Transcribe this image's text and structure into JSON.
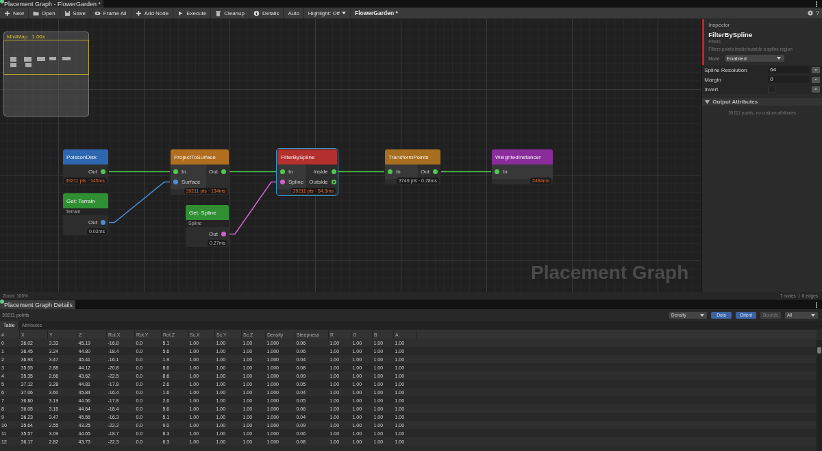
{
  "window": {
    "title": "Placement Graph - FlowerGarden *"
  },
  "toolbar": {
    "items": [
      {
        "kind": "button",
        "label": "New"
      },
      {
        "kind": "button",
        "label": "Open"
      },
      {
        "kind": "button",
        "label": "Save"
      },
      {
        "kind": "button",
        "label": "Frame All"
      },
      {
        "kind": "button",
        "label": "Add Node"
      },
      {
        "kind": "button",
        "label": "Execute"
      },
      {
        "kind": "button",
        "label": "Cleanup"
      },
      {
        "kind": "button",
        "label": "Details"
      },
      {
        "kind": "text",
        "label": "Auto"
      },
      {
        "kind": "dropdown",
        "label": "Highlight: Off"
      }
    ],
    "document": "FlowerGarden *",
    "help": "?"
  },
  "graph": {
    "minimap": {
      "label": "MiniMap",
      "zoom": "1.00x"
    },
    "watermark": "Placement Graph",
    "nodes": [
      {
        "title": "PoissonDisk",
        "color": "#2d67b2",
        "selected": false,
        "outputs": [
          {
            "label": "Out",
            "color": "#4fc94f",
            "connected": true
          }
        ],
        "stats": "39211 pts · 145ms",
        "stats_hot": true
      },
      {
        "title": "Get: Terrain",
        "color": "#2f8f33",
        "subtitle": "Terrain",
        "selected": false,
        "outputs": [
          {
            "label": "Out",
            "color": "#4d8fd6",
            "connected": true
          }
        ],
        "stats": "0.02ms",
        "stats_hot": false
      },
      {
        "title": "ProjectToSurface",
        "color": "#b06e1e",
        "selected": false,
        "inputs": [
          {
            "label": "In",
            "color": "#4fc94f",
            "connected": true
          },
          {
            "label": "Surface",
            "color": "#4d8fd6",
            "connected": true
          }
        ],
        "outputs": [
          {
            "label": "Out",
            "color": "#4fc94f",
            "connected": true
          }
        ],
        "stats": "39211 pts · 134ms",
        "stats_hot": true
      },
      {
        "title": "Get: Spline",
        "color": "#2f8f33",
        "subtitle": "Spline",
        "selected": false,
        "outputs": [
          {
            "label": "Out",
            "color": "#d35fd3",
            "connected": true
          }
        ],
        "stats": "0.27ms",
        "stats_hot": false
      },
      {
        "title": "FilterBySpline",
        "color": "#b3302f",
        "selected": true,
        "inputs": [
          {
            "label": "In",
            "color": "#4fc94f",
            "connected": true
          },
          {
            "label": "Spline",
            "color": "#d35fd3",
            "connected": true
          }
        ],
        "outputs": [
          {
            "label": "Inside",
            "color": "#4fc94f",
            "connected": true
          },
          {
            "label": "Outside",
            "color": "#4fc94f",
            "connected": false
          }
        ],
        "stats": "39211 pts · 54.3ms",
        "stats_hot": true
      },
      {
        "title": "TransformPoints",
        "color": "#a86e1f",
        "selected": false,
        "inputs": [
          {
            "label": "In",
            "color": "#4fc94f",
            "connected": true
          }
        ],
        "outputs": [
          {
            "label": "Out",
            "color": "#4fc94f",
            "connected": true
          }
        ],
        "stats": "3749 pts · 0.28ms",
        "stats_hot": false
      },
      {
        "title": "WeightedInstancer",
        "color": "#8a2c9c",
        "selected": false,
        "inputs": [
          {
            "label": "In",
            "color": "#4fc94f",
            "connected": true
          }
        ],
        "stats": "2484ms",
        "stats_hot": true
      }
    ],
    "status": {
      "zoom": "Zoom: 100%",
      "nodes": "7 nodes",
      "edges": "6 edges"
    }
  },
  "inspector": {
    "header": "Inspector",
    "title": "FilterBySpline",
    "category": "Filters",
    "description": "Filters points inside/outside a spline region",
    "mode": {
      "label": "Mode",
      "value": "Enabled"
    },
    "properties": [
      {
        "kind": "number",
        "label": "Spline Resolution",
        "value": "64"
      },
      {
        "kind": "number",
        "label": "Margin",
        "value": "0"
      },
      {
        "kind": "checkbox",
        "label": "Invert",
        "checked": false
      }
    ],
    "output_section": {
      "title": "Output Attributes",
      "expanded": true,
      "text": "39211 points, no custom attributes"
    }
  },
  "details": {
    "title": "Placement Graph Details",
    "count": "39211 points",
    "color_by": "Density",
    "toggles": [
      {
        "label": "Dots",
        "on": true
      },
      {
        "label": "Orient",
        "on": true
      },
      {
        "label": "Bounds",
        "on": false
      }
    ],
    "filter": "All",
    "tabs": [
      {
        "label": "Table",
        "selected": true
      },
      {
        "label": "Attributes",
        "selected": false
      }
    ],
    "table": {
      "columns": [
        "#",
        "X",
        "Y",
        "Z",
        "Rot.X",
        "Rot.Y",
        "Rot.Z",
        "Sc.X",
        "Sc.Y",
        "Sc.Z",
        "Density",
        "Steepness",
        "R",
        "G",
        "B",
        "A"
      ],
      "rows": [
        [
          "0",
          "36.02",
          "3.33",
          "45.19",
          "-16.8",
          "0.0",
          "5.1",
          "1.00",
          "1.00",
          "1.00",
          "1.000",
          "0.06",
          "1.00",
          "1.00",
          "1.00",
          "1.00"
        ],
        [
          "1",
          "36.45",
          "3.24",
          "44.80",
          "-18.4",
          "0.0",
          "5.6",
          "1.00",
          "1.00",
          "1.00",
          "1.000",
          "0.06",
          "1.00",
          "1.00",
          "1.00",
          "1.00"
        ],
        [
          "2",
          "36.93",
          "3.47",
          "45.41",
          "-16.1",
          "0.0",
          "1.9",
          "1.00",
          "1.00",
          "1.00",
          "1.000",
          "0.04",
          "1.00",
          "1.00",
          "1.00",
          "1.00"
        ],
        [
          "3",
          "35.55",
          "2.88",
          "44.12",
          "-20.8",
          "0.0",
          "8.6",
          "1.00",
          "1.00",
          "1.00",
          "1.000",
          "0.08",
          "1.00",
          "1.00",
          "1.00",
          "1.00"
        ],
        [
          "4",
          "35.35",
          "2.66",
          "43.62",
          "-22.5",
          "0.0",
          "8.6",
          "1.00",
          "1.00",
          "1.00",
          "1.000",
          "0.09",
          "1.00",
          "1.00",
          "1.00",
          "1.00"
        ],
        [
          "5",
          "37.12",
          "3.28",
          "44.81",
          "-17.8",
          "0.0",
          "2.6",
          "1.00",
          "1.00",
          "1.00",
          "1.000",
          "0.05",
          "1.00",
          "1.00",
          "1.00",
          "1.00"
        ],
        [
          "6",
          "37.06",
          "3.60",
          "45.84",
          "-16.4",
          "0.0",
          "1.6",
          "1.00",
          "1.00",
          "1.00",
          "1.000",
          "0.04",
          "1.00",
          "1.00",
          "1.00",
          "1.00"
        ],
        [
          "7",
          "36.80",
          "3.19",
          "44.56",
          "-17.8",
          "0.0",
          "2.6",
          "1.00",
          "1.00",
          "1.00",
          "1.000",
          "0.05",
          "1.00",
          "1.00",
          "1.00",
          "1.00"
        ],
        [
          "8",
          "36.05",
          "3.15",
          "44.64",
          "-18.4",
          "0.0",
          "5.6",
          "1.00",
          "1.00",
          "1.00",
          "1.000",
          "0.06",
          "1.00",
          "1.00",
          "1.00",
          "1.00"
        ],
        [
          "9",
          "36.23",
          "3.47",
          "45.56",
          "-16.3",
          "0.0",
          "5.1",
          "1.00",
          "1.00",
          "1.00",
          "1.000",
          "0.04",
          "1.00",
          "1.00",
          "1.00",
          "1.00"
        ],
        [
          "10",
          "35.64",
          "2.55",
          "43.25",
          "-22.2",
          "0.0",
          "9.0",
          "1.00",
          "1.00",
          "1.00",
          "1.000",
          "0.09",
          "1.00",
          "1.00",
          "1.00",
          "1.00"
        ],
        [
          "11",
          "35.57",
          "3.09",
          "44.65",
          "-18.7",
          "0.0",
          "8.3",
          "1.00",
          "1.00",
          "1.00",
          "1.000",
          "0.06",
          "1.00",
          "1.00",
          "1.00",
          "1.00"
        ],
        [
          "12",
          "36.17",
          "2.82",
          "43.73",
          "-22.3",
          "0.0",
          "6.3",
          "1.00",
          "1.00",
          "1.00",
          "1.000",
          "0.08",
          "1.00",
          "1.00",
          "1.00",
          "1.00"
        ]
      ]
    }
  }
}
